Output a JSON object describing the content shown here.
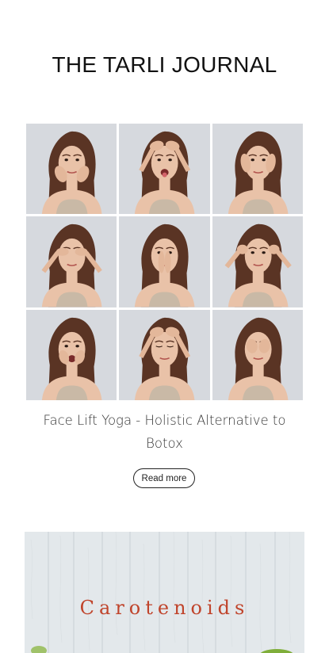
{
  "journal": {
    "title": "THE TARLI JOURNAL"
  },
  "post1": {
    "image_alt": "woman doing face yoga poses grid",
    "title": "Face Lift Yoga - Holistic Alternative to Botox",
    "read_more": "Read more"
  },
  "post2": {
    "label": "Carotenoids"
  },
  "colors": {
    "background": "#ffffff",
    "photo_backdrop": "#d6d9de",
    "skin": "#e9c2a8",
    "hair": "#5a3424",
    "top": "#c9b9a6",
    "carotenoid_text": "#c0442b",
    "wood": "#e6eaec"
  }
}
